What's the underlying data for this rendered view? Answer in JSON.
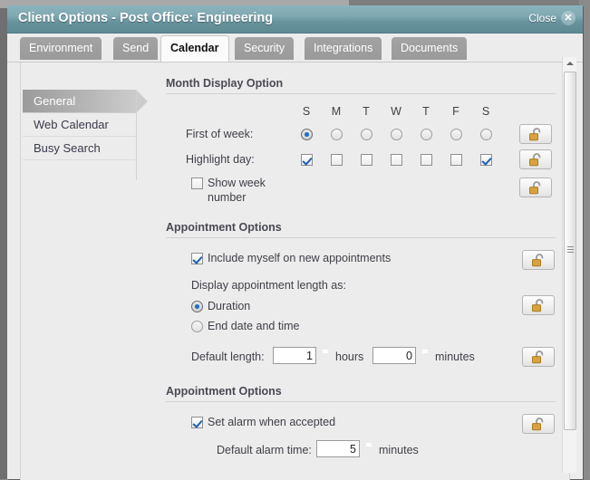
{
  "window": {
    "title": "Client Options - Post Office: Engineering",
    "close_label": "Close",
    "close_icon": "close-icon"
  },
  "tabs": [
    {
      "label": "Environment",
      "active": false
    },
    {
      "label": "Send",
      "active": false
    },
    {
      "label": "Calendar",
      "active": true
    },
    {
      "label": "Security",
      "active": false
    },
    {
      "label": "Integrations",
      "active": false
    },
    {
      "label": "Documents",
      "active": false
    }
  ],
  "sidebar": {
    "items": [
      {
        "label": "General",
        "active": true
      },
      {
        "label": "Web Calendar",
        "active": false
      },
      {
        "label": "Busy Search",
        "active": false
      }
    ]
  },
  "sections": {
    "month_display": {
      "header": "Month Display Option",
      "day_headers": [
        "S",
        "M",
        "T",
        "W",
        "T",
        "F",
        "S"
      ],
      "first_of_week": {
        "label": "First of week:",
        "selected_index": 0,
        "lock_icon": "unlocked-padlock-icon"
      },
      "highlight_day": {
        "label": "Highlight day:",
        "checked": [
          true,
          false,
          false,
          false,
          false,
          false,
          true
        ],
        "lock_icon": "unlocked-padlock-icon"
      },
      "show_week_number": {
        "label_line1": "Show week",
        "label_line2": "number",
        "checked": false,
        "lock_icon": "unlocked-padlock-icon"
      }
    },
    "appointment_options_1": {
      "header": "Appointment Options",
      "include_myself": {
        "label": "Include myself on new appointments",
        "checked": true,
        "lock_icon": "unlocked-padlock-icon"
      },
      "display_length_label": "Display appointment length as:",
      "length_mode": {
        "options": [
          "Duration",
          "End date and time"
        ],
        "selected_index": 0,
        "lock_icon": "unlocked-padlock-icon"
      },
      "default_length": {
        "label": "Default length:",
        "hours_value": "1",
        "hours_unit": "hours",
        "minutes_value": "0",
        "minutes_unit": "minutes",
        "lock_icon": "unlocked-padlock-icon"
      }
    },
    "appointment_options_2": {
      "header": "Appointment Options",
      "set_alarm": {
        "label": "Set alarm when accepted",
        "checked": true,
        "lock_icon": "unlocked-padlock-icon"
      },
      "default_alarm_time": {
        "label": "Default alarm time:",
        "value": "5",
        "unit": "minutes"
      }
    }
  },
  "scrollbar": {
    "up_arrow_icon": "chevron-up-icon",
    "grip_icon": "grip-lines-icon"
  },
  "colors": {
    "titlebar": "#7fa9b2",
    "accent_blue": "#1d6fc1",
    "lock_body": "#d9a241",
    "panel_bg": "#ececec"
  }
}
